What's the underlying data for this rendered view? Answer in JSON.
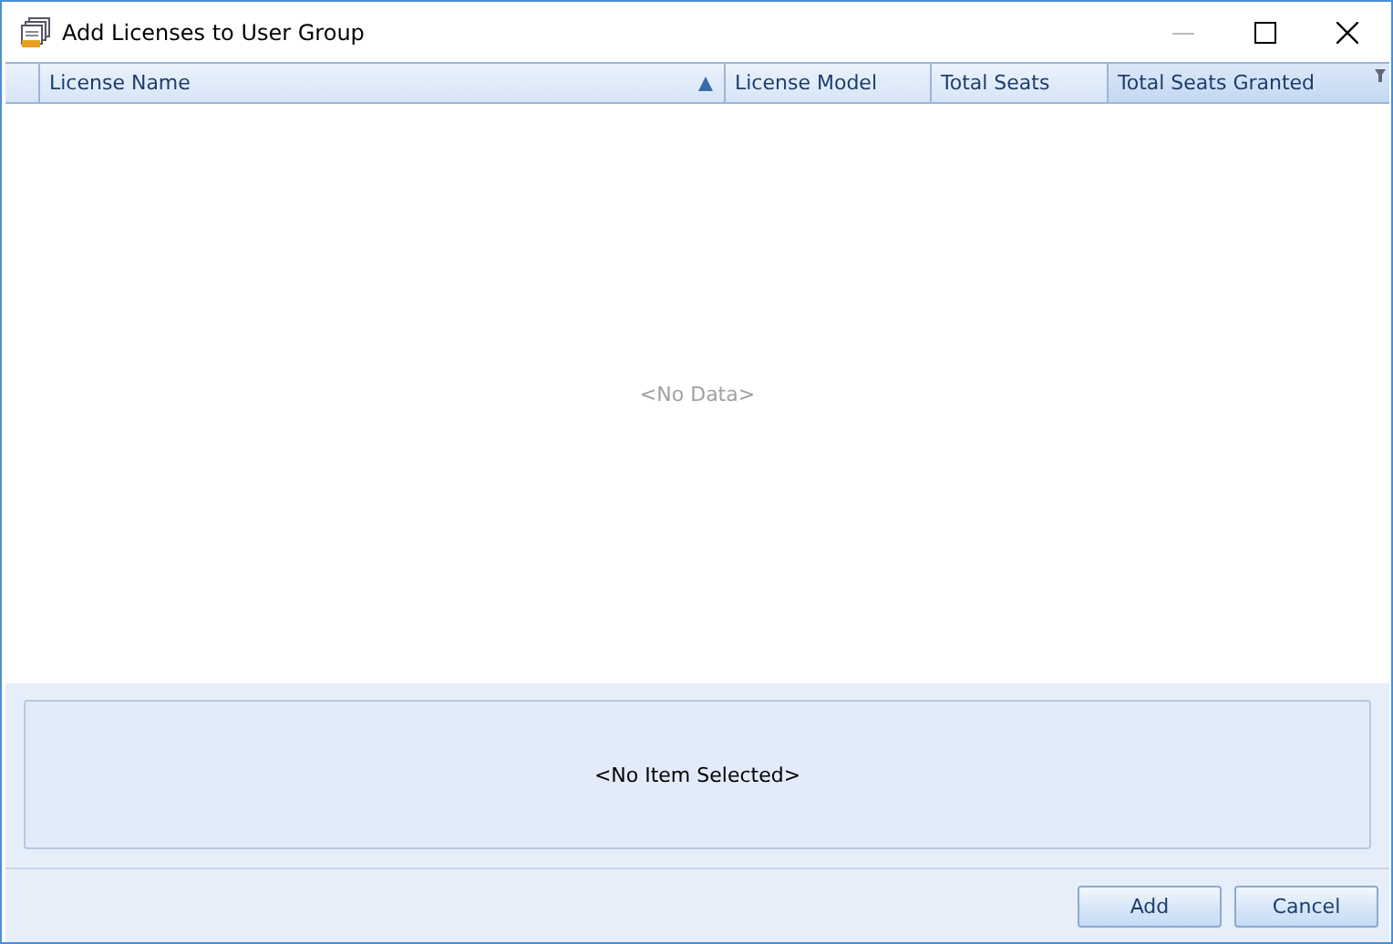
{
  "window": {
    "title": "Add Licenses to User Group"
  },
  "table": {
    "columns": [
      {
        "label": "License Name",
        "sorted": true,
        "filtered": false
      },
      {
        "label": "License Model",
        "sorted": false,
        "filtered": false
      },
      {
        "label": "Total Seats",
        "sorted": false,
        "filtered": false
      },
      {
        "label": "Total Seats Granted",
        "sorted": false,
        "filtered": true
      }
    ],
    "empty_text": "<No Data>"
  },
  "details": {
    "empty_text": "<No Item Selected>"
  },
  "buttons": [
    {
      "label": "Add"
    },
    {
      "label": "Cancel"
    }
  ]
}
